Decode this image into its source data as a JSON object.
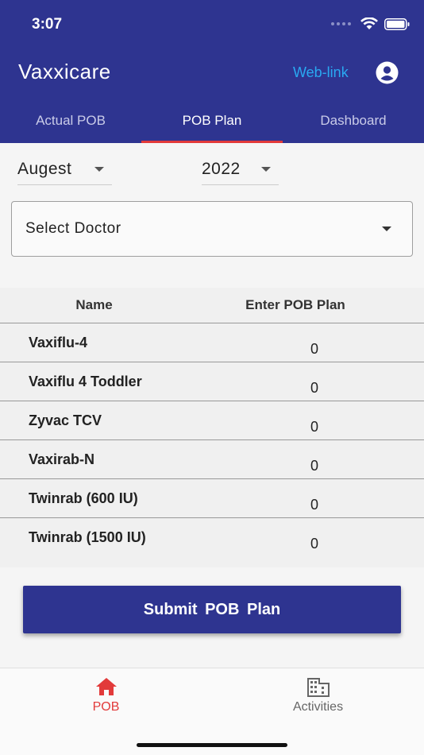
{
  "status_bar": {
    "time": "3:07"
  },
  "app": {
    "title": "Vaxxicare",
    "web_link": "Web-link"
  },
  "tabs": [
    {
      "label": "Actual POB",
      "active": false
    },
    {
      "label": "POB Plan",
      "active": true
    },
    {
      "label": "Dashboard",
      "active": false
    }
  ],
  "filters": {
    "month": "Augest",
    "year": "2022",
    "doctor_placeholder": "Select Doctor"
  },
  "table": {
    "headers": {
      "name": "Name",
      "plan": "Enter POB Plan"
    },
    "rows": [
      {
        "name": "Vaxiflu-4",
        "value": "0"
      },
      {
        "name": "Vaxiflu 4 Toddler",
        "value": "0"
      },
      {
        "name": "Zyvac TCV",
        "value": "0"
      },
      {
        "name": "Vaxirab-N",
        "value": "0"
      },
      {
        "name": "Twinrab (600 IU)",
        "value": "0"
      },
      {
        "name": "Twinrab (1500 IU)",
        "value": "0"
      }
    ]
  },
  "submit_label": "Submit POB Plan",
  "bottom_nav": [
    {
      "label": "POB",
      "icon": "home-icon",
      "active": true
    },
    {
      "label": "Activities",
      "icon": "building-icon",
      "active": false
    }
  ],
  "colors": {
    "primary": "#2e3490",
    "accent": "#e23a3a",
    "link": "#29a9f2"
  }
}
